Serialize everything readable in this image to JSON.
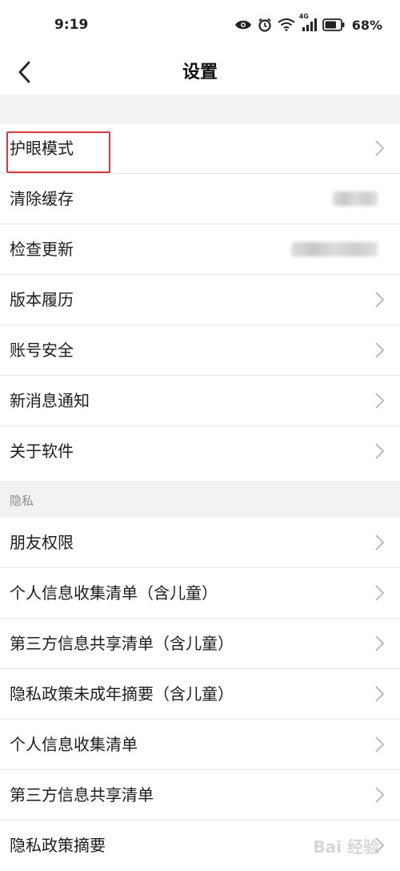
{
  "status_bar": {
    "time": "9:19",
    "network": "4G",
    "battery": "68%",
    "icons": [
      "eye-icon",
      "alarm-icon",
      "wifi-icon",
      "signal-icon",
      "battery-icon"
    ]
  },
  "header": {
    "title": "设置",
    "back_icon": "chevron-left-icon"
  },
  "settings_group": {
    "items": [
      {
        "label": "护眼模式",
        "has_chevron": true
      },
      {
        "label": "清除缓存",
        "has_chevron": false
      },
      {
        "label": "检查更新",
        "has_chevron": false
      },
      {
        "label": "版本履历",
        "has_chevron": true
      },
      {
        "label": "账号安全",
        "has_chevron": true
      },
      {
        "label": "新消息通知",
        "has_chevron": true
      },
      {
        "label": "关于软件",
        "has_chevron": true
      }
    ]
  },
  "privacy_group": {
    "header": "隐私",
    "items": [
      {
        "label": "朋友权限"
      },
      {
        "label": "个人信息收集清单（含儿童）"
      },
      {
        "label": "第三方信息共享清单（含儿童）"
      },
      {
        "label": "隐私政策未成年摘要（含儿童）"
      },
      {
        "label": "个人信息收集清单"
      },
      {
        "label": "第三方信息共享清单"
      },
      {
        "label": "隐私政策摘要"
      }
    ]
  },
  "colors": {
    "highlight": "#d9363e",
    "section_bg": "#f2f2f2",
    "divider": "#e8e8e8"
  },
  "watermark": "Bai 经验"
}
